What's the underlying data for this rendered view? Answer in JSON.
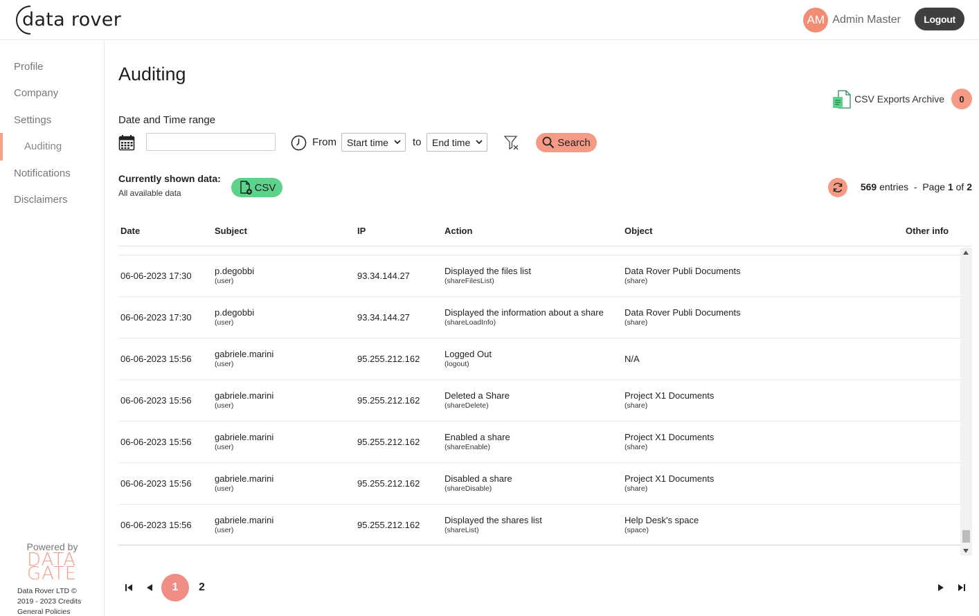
{
  "header": {
    "logo_text": "data rover",
    "avatar_initials": "AM",
    "user_name": "Admin Master",
    "logout_label": "Logout"
  },
  "sidebar": {
    "items": [
      {
        "label": "Profile"
      },
      {
        "label": "Company"
      },
      {
        "label": "Settings"
      },
      {
        "label": "Auditing"
      },
      {
        "label": "Notifications"
      },
      {
        "label": "Disclaimers"
      }
    ],
    "active_item": "Auditing",
    "powered_by": "Powered by",
    "brand_line1": "DATA",
    "brand_line2": "GATE",
    "copyright_line1": "Data Rover LTD ©",
    "copyright_line2": "2019 - 2023 Credits",
    "copyright_line3": "General Policies"
  },
  "main": {
    "title": "Auditing",
    "csv_archive_label": "CSV Exports Archive",
    "csv_archive_count": "0",
    "range_label": "Date and Time range",
    "date_input_value": "",
    "from_label": "From",
    "start_time_value": "Start time",
    "to_label": "to",
    "end_time_value": "End time",
    "search_label": "Search",
    "shown_title": "Currently shown data:",
    "shown_sub": "All available data",
    "csv_label": "CSV",
    "entries_count": "569",
    "entries_label": "entries",
    "page_prefix": "Page",
    "page_current": "1",
    "page_of": "of",
    "page_total": "2"
  },
  "table": {
    "columns": [
      "Date",
      "Subject",
      "IP",
      "Action",
      "Object",
      "Other info"
    ],
    "rows": [
      {
        "date": "06-06-2023 17:30",
        "subject": "p.degobbi",
        "subject_type": "(user)",
        "ip": "93.34.144.27",
        "action": "Displayed the files list",
        "action_code": "(shareFilesList)",
        "object": "Data Rover Publi Documents",
        "object_type": "(share)"
      },
      {
        "date": "06-06-2023 17:30",
        "subject": "p.degobbi",
        "subject_type": "(user)",
        "ip": "93.34.144.27",
        "action": "Displayed the information about a share",
        "action_code": "(shareLoadInfo)",
        "object": "Data Rover Publi Documents",
        "object_type": "(share)"
      },
      {
        "date": "06-06-2023 15:56",
        "subject": "gabriele.marini",
        "subject_type": "(user)",
        "ip": "95.255.212.162",
        "action": "Logged Out",
        "action_code": "(logout)",
        "object": "N/A",
        "object_type": ""
      },
      {
        "date": "06-06-2023 15:56",
        "subject": "gabriele.marini",
        "subject_type": "(user)",
        "ip": "95.255.212.162",
        "action": "Deleted a Share",
        "action_code": "(shareDelete)",
        "object": "Project X1 Documents",
        "object_type": "(share)"
      },
      {
        "date": "06-06-2023 15:56",
        "subject": "gabriele.marini",
        "subject_type": "(user)",
        "ip": "95.255.212.162",
        "action": "Enabled a share",
        "action_code": "(shareEnable)",
        "object": "Project X1 Documents",
        "object_type": "(share)"
      },
      {
        "date": "06-06-2023 15:56",
        "subject": "gabriele.marini",
        "subject_type": "(user)",
        "ip": "95.255.212.162",
        "action": "Disabled a share",
        "action_code": "(shareDisable)",
        "object": "Project X1 Documents",
        "object_type": "(share)"
      },
      {
        "date": "06-06-2023 15:56",
        "subject": "gabriele.marini",
        "subject_type": "(user)",
        "ip": "95.255.212.162",
        "action": "Displayed the shares list",
        "action_code": "(shareList)",
        "object": "Help Desk's space",
        "object_type": "(space)"
      }
    ]
  },
  "pagination": {
    "pages": [
      "1",
      "2"
    ],
    "current": "1"
  },
  "colors": {
    "accent": "#f59b85",
    "avatar": "#f08d74",
    "csv_green": "#5cd28a",
    "logout_bg": "#3f3f3f"
  },
  "icons": [
    "calendar-icon",
    "clock-icon",
    "chevron-down-icon",
    "filter-clear-icon",
    "search-icon",
    "csv-file-icon",
    "csv-archive-icon",
    "refresh-icon",
    "first-page-icon",
    "prev-page-icon",
    "next-page-icon",
    "last-page-icon"
  ]
}
